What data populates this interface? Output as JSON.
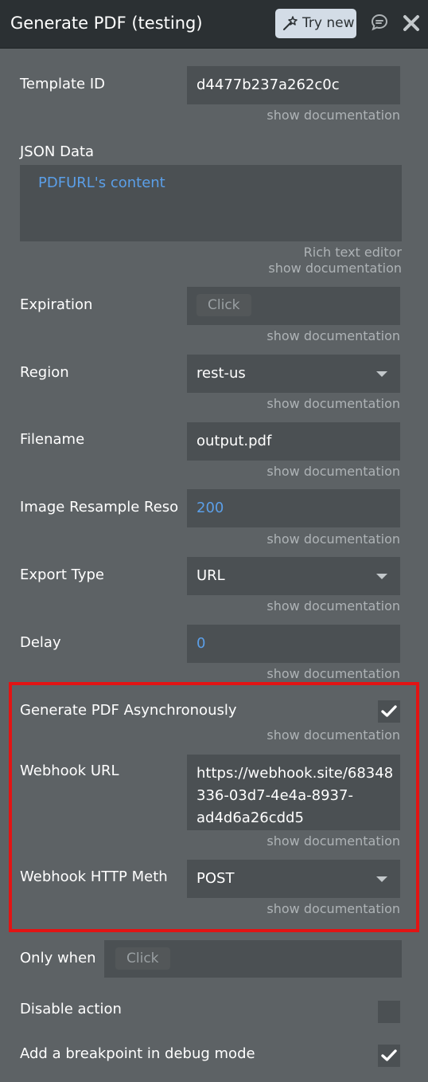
{
  "header": {
    "title": "Generate PDF (testing)",
    "try_new_label": "Try new"
  },
  "fields": {
    "template_id": {
      "label": "Template ID",
      "value": "d4477b237a262c0c",
      "doc": "show documentation"
    },
    "json_data": {
      "label": "JSON Data",
      "value": "PDFURL's content",
      "editor": "Rich text editor",
      "doc": "show documentation"
    },
    "expiration": {
      "label": "Expiration",
      "placeholder": "Click",
      "doc": "show documentation"
    },
    "region": {
      "label": "Region",
      "value": "rest-us",
      "doc": "show documentation"
    },
    "filename": {
      "label": "Filename",
      "value": "output.pdf",
      "doc": "show documentation"
    },
    "image_resample": {
      "label": "Image Resample Reso",
      "value": "200",
      "doc": "show documentation"
    },
    "export_type": {
      "label": "Export Type",
      "value": "URL",
      "doc": "show documentation"
    },
    "delay": {
      "label": "Delay",
      "value": "0",
      "doc": "show documentation"
    },
    "async": {
      "label": "Generate PDF Asynchronously",
      "checked": true,
      "doc": "show documentation"
    },
    "webhook_url": {
      "label": "Webhook URL",
      "value_lines": [
        "https://webhook.site/68348",
        "336-03d7-4e4a-8937-",
        "ad4d6a26cdd5"
      ],
      "doc": "show documentation"
    },
    "webhook_method": {
      "label": "Webhook HTTP Meth",
      "value": "POST",
      "doc": "show documentation"
    }
  },
  "footer": {
    "only_when": {
      "label": "Only when",
      "placeholder": "Click"
    },
    "disable_action": {
      "label": "Disable action",
      "checked": false
    },
    "breakpoint": {
      "label": "Add a breakpoint in debug mode",
      "checked": true
    }
  },
  "colors": {
    "panel_bg": "#5d6265",
    "header_bg": "#2b3033",
    "input_bg": "#4b5053",
    "link_blue": "#5b9fe8",
    "highlight_red": "#e21414"
  }
}
